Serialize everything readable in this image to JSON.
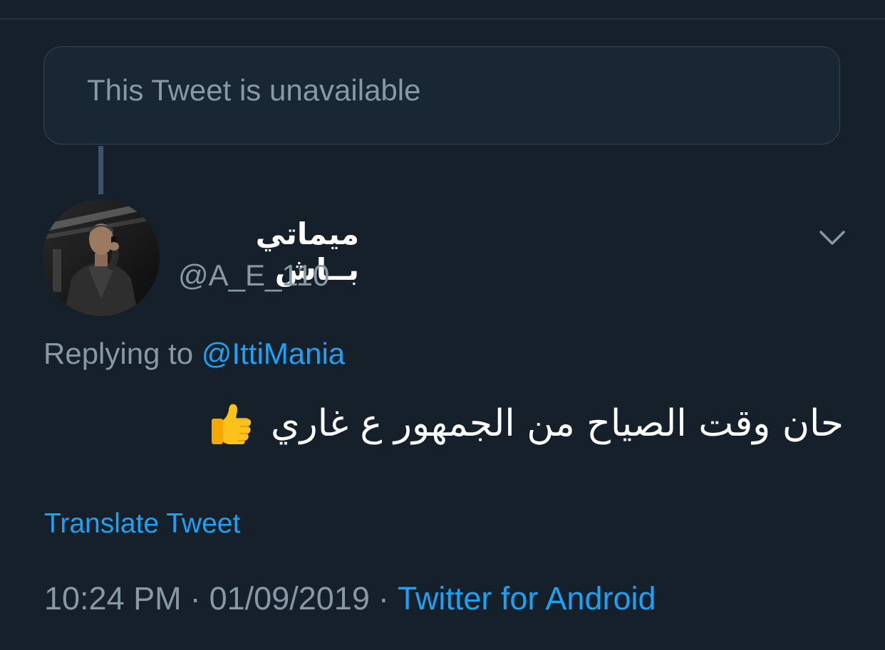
{
  "unavailable_card": {
    "text": "This Tweet is unavailable"
  },
  "tweet": {
    "author": {
      "display_name": "ميماتي بــاش",
      "handle": "@A_E_110",
      "avatar": "profile-photo-man-on-phone"
    },
    "reply": {
      "prefix": "Replying to",
      "handle": "@IttiMania"
    },
    "text": "حان وقت الصياح من الجمهور ع غاري",
    "emoji": "thumbs-up",
    "translate_label": "Translate Tweet",
    "time": "10:24 PM",
    "separator": "·",
    "date": "01/09/2019",
    "source": "Twitter for Android",
    "menu_icon": "chevron-down-icon"
  },
  "colors": {
    "background": "#15202b",
    "card_background": "#192734",
    "border": "#38444d",
    "secondary_text": "#8899a6",
    "accent": "#1da1f2",
    "primary_text": "#ffffff"
  }
}
